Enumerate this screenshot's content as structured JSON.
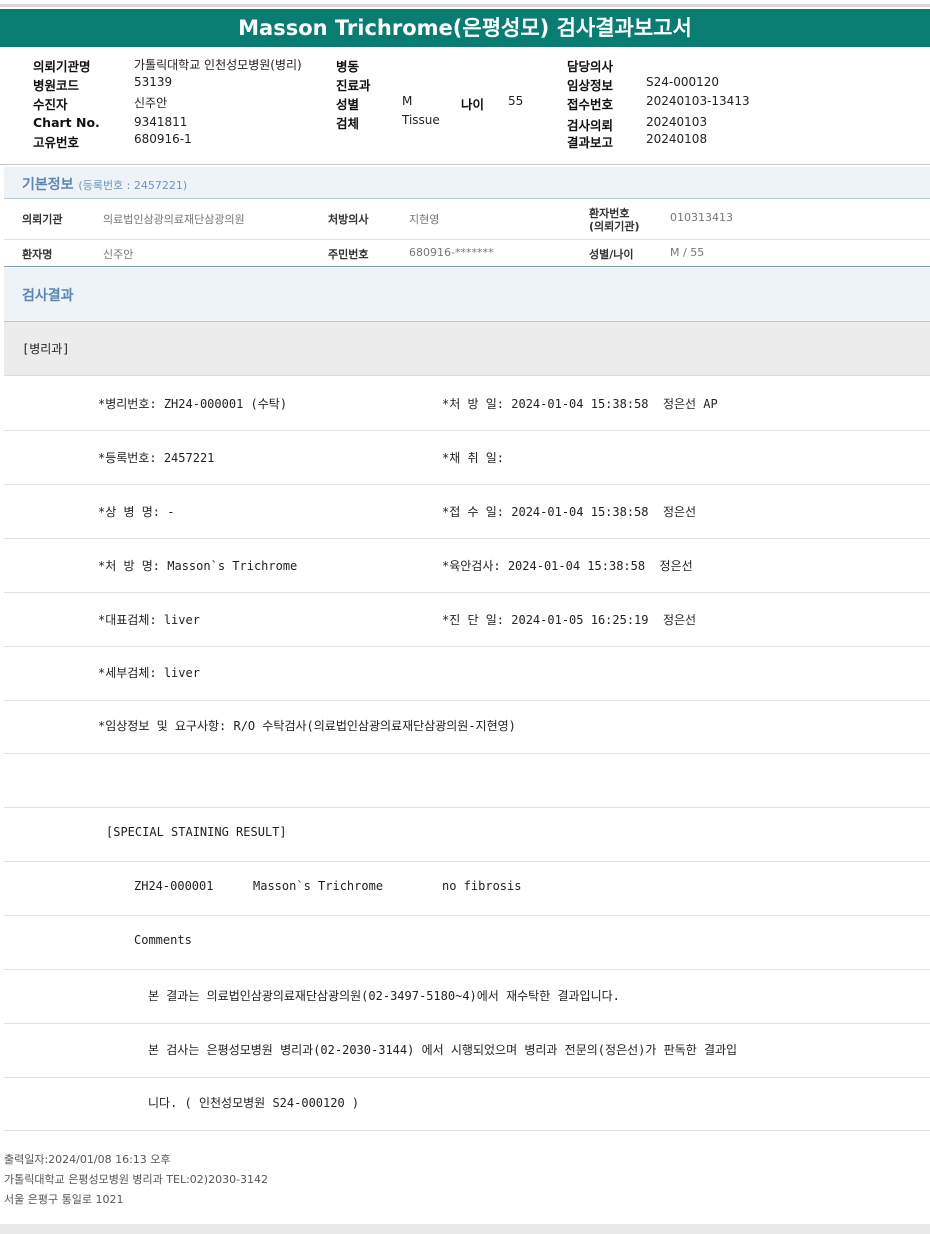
{
  "report": {
    "title": "Masson Trichrome(은평성모) 검사결과보고서"
  },
  "header": {
    "req_org_label": "의뢰기관명",
    "req_org_value": "가톨릭대학교 인천성모병원(병리)",
    "hosp_code_label": "병원코드",
    "hosp_code_value": "53139",
    "recipient_label": "수진자",
    "recipient_value": "신주안",
    "chart_label": "Chart No.",
    "chart_value": "9341811",
    "uid_label": "고유번호",
    "uid_value": "680916-1",
    "ward_label": "병동",
    "ward_value": "",
    "dept_label": "진료과",
    "dept_value": "",
    "sex_label": "성별",
    "sex_value": "M",
    "age_label": "나이",
    "age_value": "55",
    "specimen_label": "검체",
    "specimen_value": "Tissue",
    "doctor_label": "담당의사",
    "doctor_value": "",
    "clinical_label": "임상정보",
    "clinical_value": "S24-000120",
    "receipt_label": "접수번호",
    "receipt_value": "20240103-13413",
    "request_label": "검사의뢰",
    "request_value": "20240103",
    "result_label": "결과보고",
    "result_value": "20240108"
  },
  "basic_info": {
    "title": "기본정보",
    "reg_note": "(등록번호 : 2457221)",
    "req_org_label": "의뢰기관",
    "req_org_value": "의료법인삼광의료재단삼광의원",
    "prescriber_label": "처방의사",
    "prescriber_value": "지현영",
    "patient_no_label_1": "환자번호",
    "patient_no_label_2": "(의뢰기관)",
    "patient_no_value": "010313413",
    "patient_name_label": "환자명",
    "patient_name_value": "신주안",
    "rrn_label": "주민번호",
    "rrn_value": "680916-*******",
    "sex_age_label": "성별/나이",
    "sex_age_value": "M / 55"
  },
  "results": {
    "title": "검사결과",
    "dept": "[병리과]",
    "path_no": "*병리번호: ZH24-000001 (수탁)",
    "prescribed_date": "*처 방 일: 2024-01-04 15:38:58  정은선 AP",
    "reg_no": "*등록번호: 2457221",
    "collect_date": "*채 취 일:",
    "disease": "*상 병 명: -",
    "receive_date": "*접 수 일: 2024-01-04 15:38:58  정은선",
    "prescription": "*처 방 명: Masson`s Trichrome",
    "gross_exam": "*육안검사: 2024-01-04 15:38:58  정은선",
    "rep_specimen": "*대표검체: liver",
    "diag_date": "*진 단 일: 2024-01-05 16:25:19  정은선",
    "sub_specimen": "*세부검체: liver",
    "clinical_req": "*임상정보 및 요구사항: R/O 수탁검사(의료법인삼광의료재단삼광의원-지현영)",
    "special_header": "[SPECIAL STAINING RESULT]",
    "stain_case": "ZH24-000001",
    "stain_name": "Masson`s Trichrome",
    "stain_result": "no fibrosis",
    "comments_label": "Comments",
    "comment_1": "본 결과는 의료법인삼광의료재단삼광의원(02-3497-5180~4)에서 재수탁한 결과입니다.",
    "comment_2": "본 검사는 은평성모병원 병리과(02-2030-3144) 에서 시행되었으며 병리과 전문의(정은선)가 판독한 결과입",
    "comment_3": "니다. ( 인천성모병원 S24-000120 )"
  },
  "footer": {
    "printed": "출력일자:2024/01/08 16:13 오후",
    "org": "가톨릭대학교 은평성모병원 병리과 TEL:02)2030-3142",
    "address": "서울 은평구 통일로 1021"
  }
}
